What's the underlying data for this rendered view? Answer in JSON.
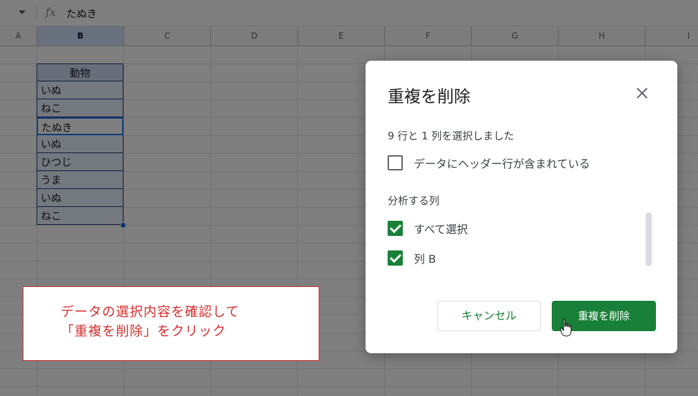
{
  "formula_bar": {
    "fx_label": "fx",
    "value": "たぬき"
  },
  "columns": [
    "A",
    "B",
    "C",
    "D",
    "E",
    "F",
    "G",
    "H",
    "I"
  ],
  "selected_column": "B",
  "data_column": {
    "header": "動物",
    "values": [
      "いぬ",
      "ねこ",
      "たぬき",
      "いぬ",
      "ひつじ",
      "うま",
      "いぬ",
      "ねこ"
    ],
    "active_value": "たぬき"
  },
  "annotation": {
    "line1": "データの選択内容を確認して",
    "line2": "「重複を削除」をクリック"
  },
  "dialog": {
    "title": "重複を削除",
    "close_icon": "close-icon",
    "selection_info": "9 行と 1 列を選択しました",
    "header_checkbox": {
      "label": "データにヘッダー行が含まれている",
      "checked": false
    },
    "columns_section_label": "分析する列",
    "column_checkboxes": [
      {
        "label": "すべて選択",
        "checked": true
      },
      {
        "label": "列 B",
        "checked": true
      }
    ],
    "cancel_label": "キャンセル",
    "remove_label": "重複を削除"
  },
  "colors": {
    "accent_green": "#188038",
    "annotation_red": "#d32f2f",
    "selection_blue": "#1a73e8"
  }
}
